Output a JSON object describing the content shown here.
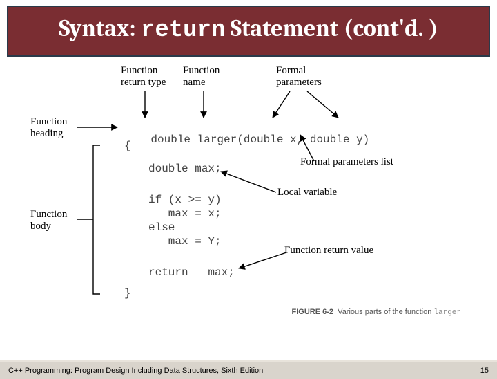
{
  "title": {
    "pre": "Syntax: ",
    "mono": "return",
    "post": " Statement (cont'd. )"
  },
  "labels": {
    "returnType": "Function\nreturn type",
    "funcName": "Function\nname",
    "formalParams": "Formal\nparameters",
    "heading": "Function\nheading",
    "paramList": "Formal parameters list",
    "localVar": "Local variable",
    "body": "Function\nbody",
    "returnVal": "Function return value"
  },
  "code": {
    "sig_type": "double",
    "sig_name": "larger",
    "sig_params": "(double x, double y)",
    "line2": "{",
    "line3": "double max;",
    "line5": "if (x >= y)",
    "line6": "   max = x;",
    "line7": "else",
    "line8": "   max = Y;",
    "line10a": "return",
    "line10b": "max;",
    "line12": "}"
  },
  "figure": {
    "prefix": "FIGURE 6-2",
    "text": "Various parts of the function",
    "mono": "larger"
  },
  "footer": {
    "left": "C++ Programming: Program Design Including Data Structures, Sixth Edition",
    "right": "15"
  }
}
